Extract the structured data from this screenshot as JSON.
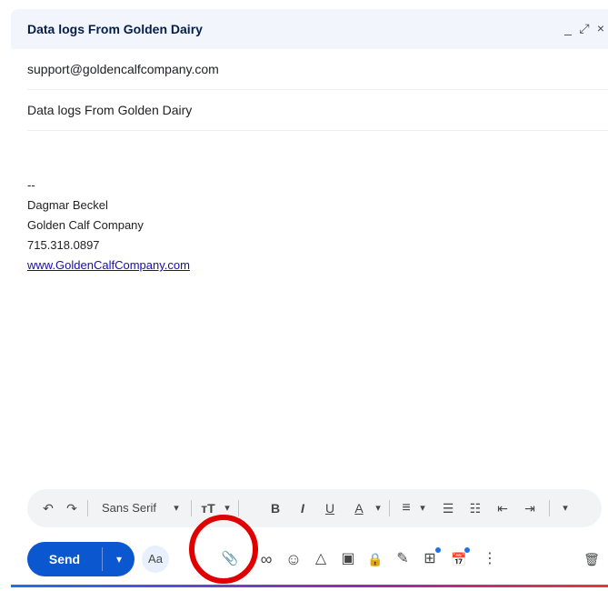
{
  "compose": {
    "title": "Data logs From Golden Dairy",
    "window_controls": {
      "minimize": "_",
      "expand": "⤢",
      "close": "×"
    },
    "to": "support@goldencalfcompany.com",
    "subject": "Data logs From Golden Dairy"
  },
  "signature": {
    "dashes": "--",
    "name": "Dagmar Beckel",
    "company": "Golden Calf Company",
    "phone": "715.318.0897",
    "website": "www.GoldenCalfCompany.com"
  },
  "format_bar": {
    "undo": "↶",
    "redo": "↷",
    "font": "Sans Serif",
    "font_caret": "▾",
    "size": "тT",
    "size_caret": "▾",
    "bold": "B",
    "italic": "I",
    "underline": "U",
    "text_color": "A",
    "text_color_caret": "▾",
    "align": "≡",
    "align_caret": "▾",
    "numbered_list": "☰",
    "bulleted_list": "☷",
    "indent_less": "⇤",
    "indent_more": "⇥",
    "more": "▾"
  },
  "bottom_toolbar": {
    "send": "Send",
    "send_more": "▾",
    "format_options": "Aa",
    "attach": "📎",
    "link": "∞",
    "emoji": "☺",
    "drive": "△",
    "photo": "▣",
    "confidential": "🔒",
    "signature": "✎",
    "layouts": "⊞",
    "schedule": "📅",
    "more_options": "⋮",
    "discard": "🗑"
  },
  "colors": {
    "send_button": "#0b57d0",
    "header_bg": "#f2f6fc",
    "highlight_ring": "#e00000",
    "link": "#1a0dab"
  }
}
